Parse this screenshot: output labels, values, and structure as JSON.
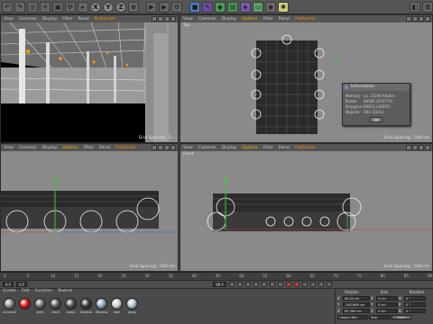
{
  "toolbar": {
    "axis_buttons": [
      "X",
      "Y",
      "Z"
    ]
  },
  "viewports": {
    "perspective": {
      "menu": [
        "View",
        "Cameras",
        "Display",
        "Filter",
        "Panel",
        "ProRender"
      ],
      "grid_spacing": "Grid Spacing : 5..."
    },
    "top": {
      "label": "Top",
      "menu": [
        "View",
        "Cameras",
        "Display",
        "Options",
        "Filter",
        "Panel",
        "ProRender"
      ],
      "grid_spacing": "Grid Spacing : 500 cm"
    },
    "right": {
      "menu": [
        "View",
        "Cameras",
        "Display",
        "Options",
        "Filter",
        "Panel",
        "ProRender"
      ],
      "grid_spacing": "Grid Spacing : 500 cm"
    },
    "front": {
      "label": "Front",
      "menu": [
        "View",
        "Cameras",
        "Display",
        "Options",
        "Filter",
        "Panel",
        "ProRender"
      ],
      "grid_spacing": "Grid Spacing : 500 cm"
    }
  },
  "info_dialog": {
    "title": "Information",
    "rows": [
      {
        "key": "Memory:",
        "value": "ca. 23290 KBytes"
      },
      {
        "key": "Points:",
        "value": "80500 (474774)"
      },
      {
        "key": "Polygons:",
        "value": "89913 (39007)"
      },
      {
        "key": "Objects:",
        "value": "381 (2241)"
      }
    ],
    "ok_label": "OK"
  },
  "timeline": {
    "ticks": [
      "0",
      "5",
      "10",
      "15",
      "20",
      "25",
      "30",
      "35",
      "40",
      "45",
      "50",
      "55",
      "60",
      "65",
      "70",
      "75",
      "80",
      "85",
      "90"
    ]
  },
  "transport": {
    "start_field": "0 F",
    "end_field": "90 F",
    "current_field": "0 F"
  },
  "materials": {
    "menu": [
      "Create",
      "Edit",
      "Function",
      "Texture"
    ],
    "items": [
      {
        "name": "uminium",
        "color": "#8a8a8a"
      },
      {
        "name": "",
        "color": "#e01818"
      },
      {
        "name": "grey",
        "color": "#6a6a6a"
      },
      {
        "name": "steel",
        "color": "#5a5a5a"
      },
      {
        "name": "metal",
        "color": "#4e4e4e"
      },
      {
        "name": "handles",
        "color": "#3a3a3a"
      },
      {
        "name": "Window",
        "color": "#8fa4b8"
      },
      {
        "name": "wall",
        "color": "#cfcfcf"
      },
      {
        "name": "glass",
        "color": "#b8c4cc"
      }
    ]
  },
  "coordinates": {
    "headers": [
      "Position",
      "Size",
      "Rotation"
    ],
    "rows": [
      {
        "axis": "X",
        "position": "85.25 cm",
        "size": "0 cm",
        "rot_label": "H",
        "rotation": "0 °"
      },
      {
        "axis": "Y",
        "position": "-162.696 cm",
        "size": "0 cm",
        "rot_label": "P",
        "rotation": "0 °"
      },
      {
        "axis": "Z",
        "position": "85.369 cm",
        "size": "0 cm",
        "rot_label": "B",
        "rotation": "0 °"
      }
    ],
    "object_mode": "Object (Rel)",
    "size_mode": "Size",
    "apply_label": "Apply"
  }
}
